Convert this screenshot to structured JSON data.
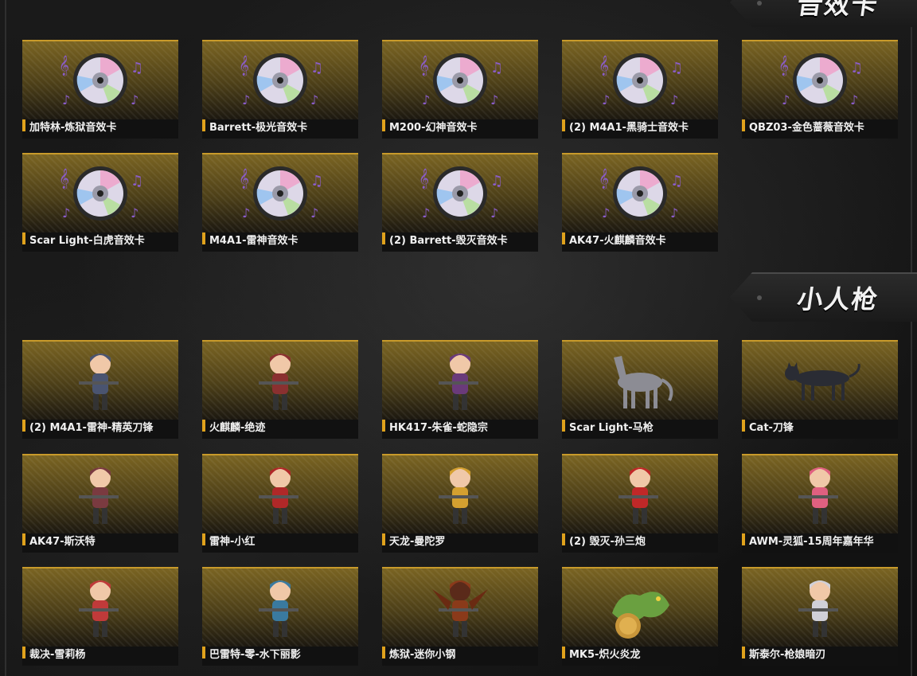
{
  "sections": {
    "music": {
      "title": "音效卡"
    },
    "guns": {
      "title": "小人枪"
    }
  },
  "music_cards": [
    {
      "label": "加特林-炼狱音效卡"
    },
    {
      "label": "Barrett-极光音效卡"
    },
    {
      "label": "M200-幻神音效卡"
    },
    {
      "label": "(2) M4A1-黑骑士音效卡"
    },
    {
      "label": "QBZ03-金色蔷薇音效卡"
    },
    {
      "label": "Scar Light-白虎音效卡"
    },
    {
      "label": "M4A1-雷神音效卡"
    },
    {
      "label": "(2) Barrett-毁灭音效卡"
    },
    {
      "label": "AK47-火麒麟音效卡"
    }
  ],
  "gun_cards": [
    {
      "label": "(2) M4A1-雷神-精英刀锋",
      "icon": "soldier-figure-icon",
      "color": "#4a5470"
    },
    {
      "label": "火麒麟-绝迹",
      "icon": "girl-figure-icon",
      "color": "#8a3030"
    },
    {
      "label": "HK417-朱雀-蛇隐宗",
      "icon": "ninja-figure-icon",
      "color": "#6a3a7a"
    },
    {
      "label": "Scar Light-马枪",
      "icon": "horse-figure-icon",
      "color": "#8c8c94"
    },
    {
      "label": "Cat-刀锋",
      "icon": "cat-figure-icon",
      "color": "#2a2c34"
    },
    {
      "label": "AK47-斯沃特",
      "icon": "soldier-figure-icon",
      "color": "#7a3a40"
    },
    {
      "label": "雷神-小红",
      "icon": "armor-figure-icon",
      "color": "#b02828"
    },
    {
      "label": "天龙-曼陀罗",
      "icon": "girl-figure-icon",
      "color": "#d4a030"
    },
    {
      "label": "(2) 毁灭-孙三炮",
      "icon": "boy-figure-icon",
      "color": "#c02828"
    },
    {
      "label": "AWM-灵狐-15周年嘉年华",
      "icon": "girl-figure-icon",
      "color": "#e06080"
    },
    {
      "label": "裁决-雪莉杨",
      "icon": "girl-figure-icon",
      "color": "#c03a3a"
    },
    {
      "label": "巴雷特-零-水下丽影",
      "icon": "diver-figure-icon",
      "color": "#3a7aa0"
    },
    {
      "label": "炼狱-迷你小钢",
      "icon": "demon-figure-icon",
      "color": "#8a3a1a"
    },
    {
      "label": "MK5-炽火炎龙",
      "icon": "dragon-figure-icon",
      "color": "#6aa040"
    },
    {
      "label": "斯泰尔-枪娘暗刃",
      "icon": "girl-figure-icon",
      "color": "#d0d0d8"
    }
  ]
}
